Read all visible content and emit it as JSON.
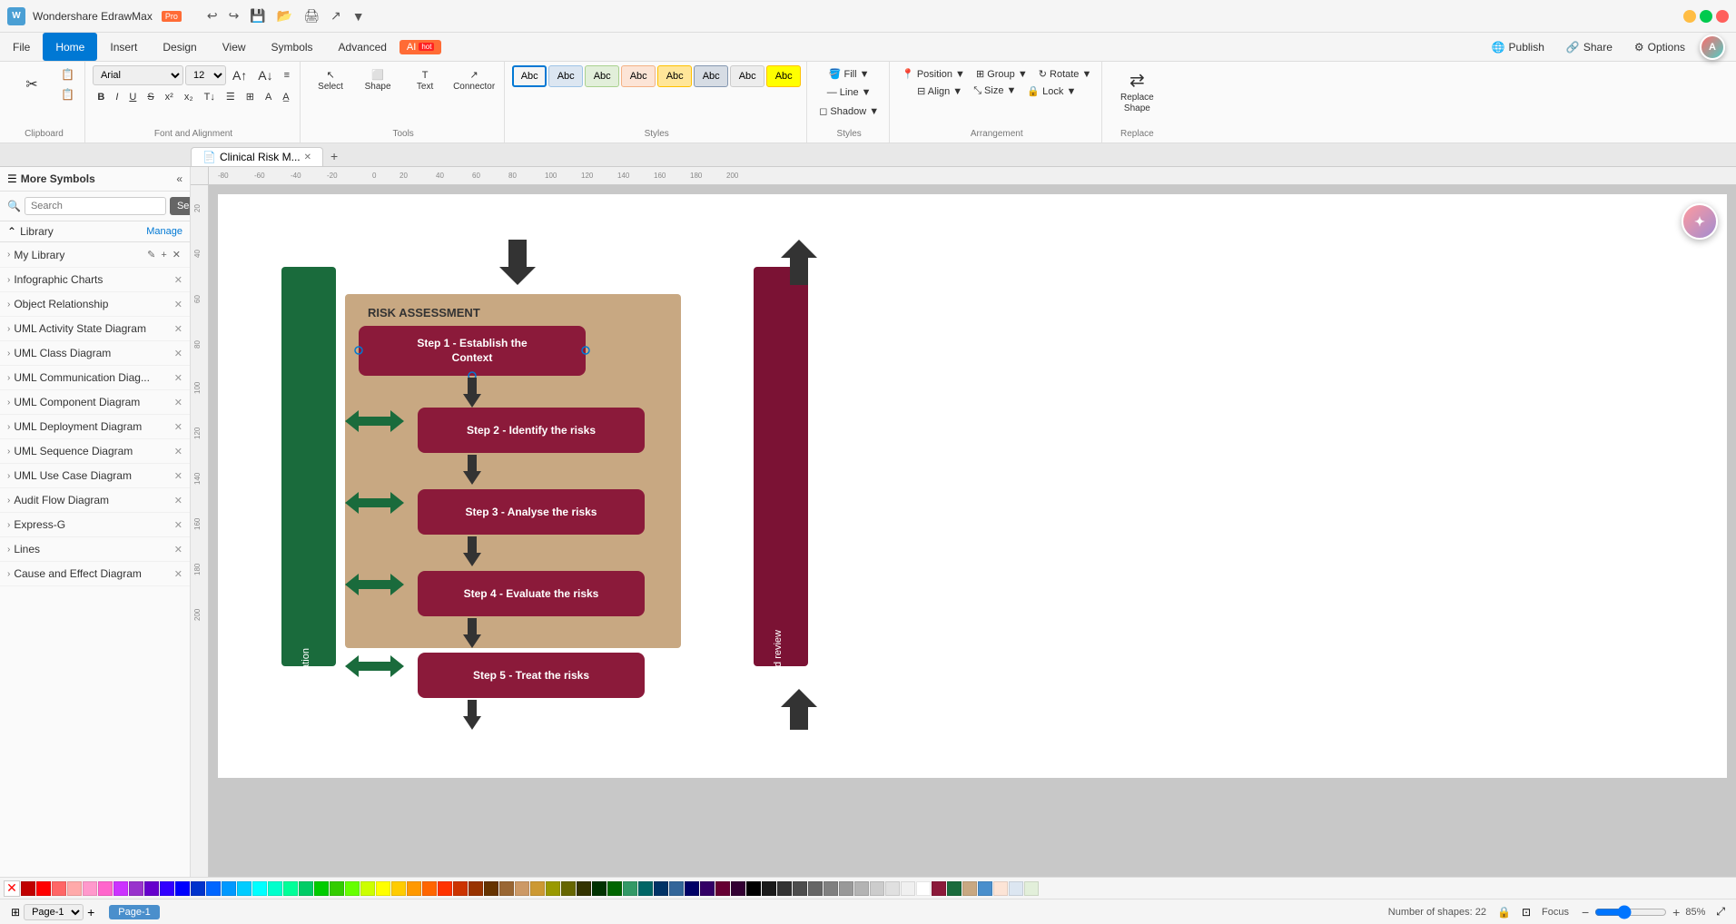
{
  "app": {
    "name": "Wondershare EdrawMax",
    "tier": "Pro",
    "document_title": "Clinical Risk M..."
  },
  "title_bar": {
    "undo_label": "↩",
    "redo_label": "↪",
    "save_icon": "💾",
    "open_icon": "📂",
    "other_icons": [
      "🖨",
      "↗",
      "▼"
    ]
  },
  "menu": {
    "items": [
      "File",
      "Home",
      "Insert",
      "Design",
      "View",
      "Symbols",
      "Advanced"
    ],
    "active": "Home",
    "right_items": [
      "Publish",
      "Share",
      "Options"
    ]
  },
  "ai_button": {
    "label": "AI",
    "badge": "hot"
  },
  "toolbar": {
    "clipboard_section": {
      "label": "Clipboard",
      "buttons": [
        "✂",
        "📋",
        "📋"
      ]
    },
    "font_section": {
      "label": "Font and Alignment",
      "font": "Arial",
      "size": "12",
      "bold": "B",
      "italic": "I",
      "underline": "U",
      "strikethrough": "S"
    },
    "tools_section": {
      "label": "Tools",
      "select_label": "Select",
      "shape_label": "Shape",
      "text_label": "Text",
      "connector_label": "Connector"
    },
    "styles_section": {
      "label": "Styles",
      "swatches": [
        "Abc",
        "Abc",
        "Abc",
        "Abc",
        "Abc",
        "Abc",
        "Abc",
        "Abc"
      ]
    },
    "fill_section": {
      "label": "Fill",
      "fill": "Fill",
      "line": "Line",
      "shadow": "Shadow"
    },
    "arrangement_section": {
      "label": "Arrangement",
      "position": "Position",
      "group": "Group",
      "rotate": "Rotate",
      "align": "Align",
      "size": "Size",
      "lock": "Lock"
    },
    "replace_section": {
      "label": "Replace",
      "replace_shape": "Replace Shape"
    }
  },
  "tabs": {
    "items": [
      "Clinical Risk M..."
    ],
    "add_label": "+"
  },
  "sidebar": {
    "title": "More Symbols",
    "search_placeholder": "Search",
    "search_btn": "Search",
    "library_label": "Library",
    "manage_label": "Manage",
    "items": [
      {
        "name": "My Library",
        "closable": false,
        "has_actions": true
      },
      {
        "name": "Infographic Charts",
        "closable": true
      },
      {
        "name": "Object Relationship",
        "closable": true
      },
      {
        "name": "UML Activity State Diagram",
        "closable": true
      },
      {
        "name": "UML Class Diagram",
        "closable": true
      },
      {
        "name": "UML Communication Diag...",
        "closable": true
      },
      {
        "name": "UML Component Diagram",
        "closable": true
      },
      {
        "name": "UML Deployment Diagram",
        "closable": true
      },
      {
        "name": "UML Sequence Diagram",
        "closable": true
      },
      {
        "name": "UML Use Case Diagram",
        "closable": true
      },
      {
        "name": "Audit Flow Diagram",
        "closable": true
      },
      {
        "name": "Express-G",
        "closable": true
      },
      {
        "name": "Lines",
        "closable": true
      },
      {
        "name": "Cause and Effect Diagram",
        "closable": true
      }
    ]
  },
  "diagram": {
    "title": "RISK ASSESSMENT",
    "left_bar_label": "Communication and Consultation",
    "right_bar_label": "Monitor and review",
    "steps": [
      {
        "id": 1,
        "label": "Step 1 - Establish the Context"
      },
      {
        "id": 2,
        "label": "Step 2 - Identify  the risks"
      },
      {
        "id": 3,
        "label": "Step 3 - Analyse the risks"
      },
      {
        "id": 4,
        "label": "Step 4 - Evaluate the risks"
      },
      {
        "id": 5,
        "label": "Step 5 - Treat the risks"
      }
    ]
  },
  "status_bar": {
    "page_label": "Page-1",
    "shapes_count": "Number of shapes: 22",
    "focus_label": "Focus",
    "zoom_level": "85%"
  },
  "color_palette": [
    "#c00000",
    "#ff0000",
    "#ff6666",
    "#ff99cc",
    "#ff66cc",
    "#cc33ff",
    "#6600cc",
    "#0000ff",
    "#0066ff",
    "#00ccff",
    "#00ffff",
    "#00ff99",
    "#00cc00",
    "#66ff00",
    "#ffff00",
    "#ffcc00",
    "#ff9900",
    "#ff6600",
    "#cc3300",
    "#996633",
    "#333300",
    "#666600",
    "#339966",
    "#006666",
    "#003366",
    "#000066",
    "#330066",
    "#660033",
    "#000000",
    "#333333",
    "#555555",
    "#777777",
    "#999999",
    "#aaaaaa",
    "#cccccc",
    "#dddddd",
    "#eeeeee",
    "#ffffff"
  ]
}
